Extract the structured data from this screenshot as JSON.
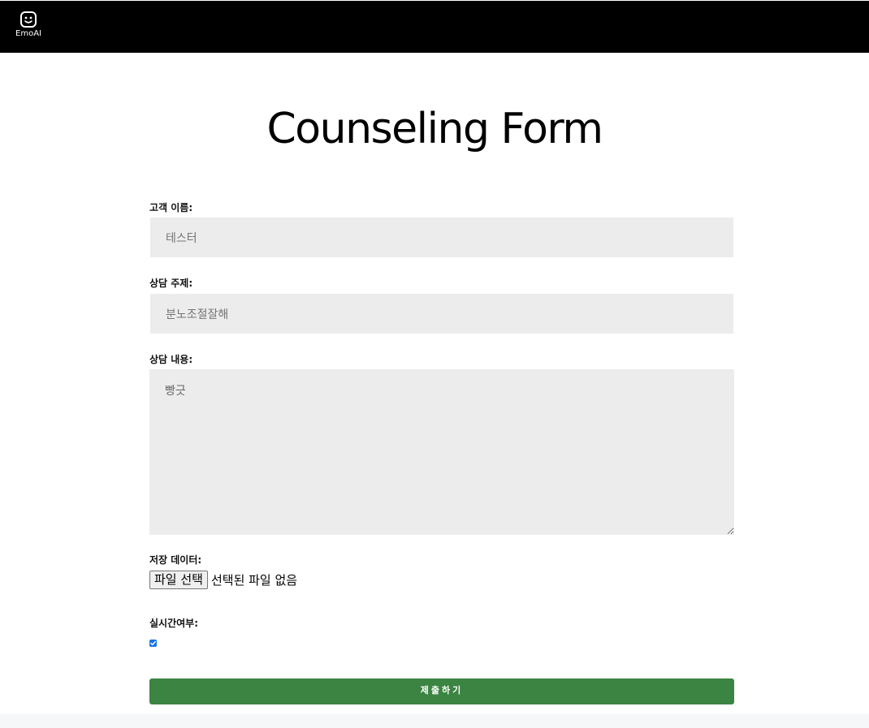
{
  "nav": {
    "logo_text": "EmoAI",
    "logo_icon": "smiley-face-icon"
  },
  "page": {
    "title": "Counseling Form"
  },
  "form": {
    "customer_name": {
      "label": "고객 이름:",
      "value": "테스터"
    },
    "topic": {
      "label": "상담 주제:",
      "value": "분노조절잘해"
    },
    "content": {
      "label": "상담 내용:",
      "value": "빵긋"
    },
    "file": {
      "label": "저장 데이터:",
      "button_label": "파일 선택",
      "status": "선택된 파일 없음"
    },
    "realtime": {
      "label": "실시간여부:",
      "checked": true
    },
    "submit_label": "제출하기"
  },
  "colors": {
    "nav_bg": "#000000",
    "input_bg": "#ececec",
    "submit_bg": "#3b8442",
    "checkbox_accent": "#1a73e8"
  }
}
